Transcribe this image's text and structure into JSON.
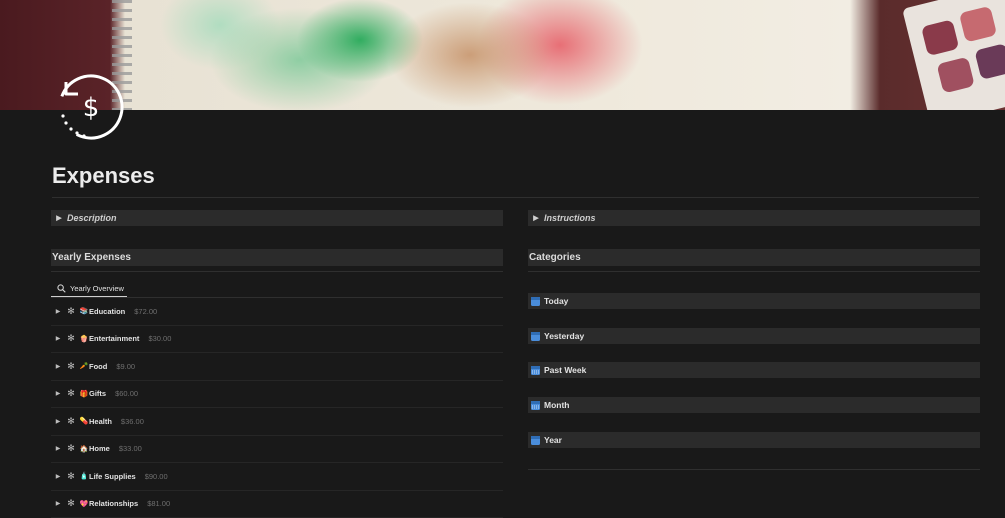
{
  "page": {
    "title": "Expenses",
    "icon": "dollar-refresh-icon"
  },
  "left": {
    "toggle_label": "Description",
    "heading": "Yearly Expenses",
    "view_tab": "Yearly Overview",
    "groups": [
      {
        "emoji": "📚",
        "name": "Education",
        "sum": "$72.00"
      },
      {
        "emoji": "🍿",
        "name": "Entertainment",
        "sum": "$30.00"
      },
      {
        "emoji": "🥕",
        "name": "Food",
        "sum": "$9.00"
      },
      {
        "emoji": "🎁",
        "name": "Gifts",
        "sum": "$60.00"
      },
      {
        "emoji": "💊",
        "name": "Health",
        "sum": "$36.00"
      },
      {
        "emoji": "🏠",
        "name": "Home",
        "sum": "$33.00"
      },
      {
        "emoji": "🧴",
        "name": "Life Supplies",
        "sum": "$90.00"
      },
      {
        "emoji": "💖",
        "name": "Relationships",
        "sum": "$81.00"
      }
    ]
  },
  "right": {
    "toggle_label": "Instructions",
    "heading": "Categories",
    "categories": [
      {
        "label": "Today",
        "icon": "calendar-day-icon"
      },
      {
        "label": "Yesterday",
        "icon": "calendar-day-icon"
      },
      {
        "label": "Past Week",
        "icon": "calendar-week-icon"
      },
      {
        "label": "Month",
        "icon": "calendar-month-icon"
      },
      {
        "label": "Year",
        "icon": "calendar-year-icon"
      }
    ]
  },
  "colors": {
    "background": "#191919",
    "bar": "#2b2b2b",
    "calendar_icon": "#4a8ddb",
    "muted_text": "#6f6f6f"
  }
}
